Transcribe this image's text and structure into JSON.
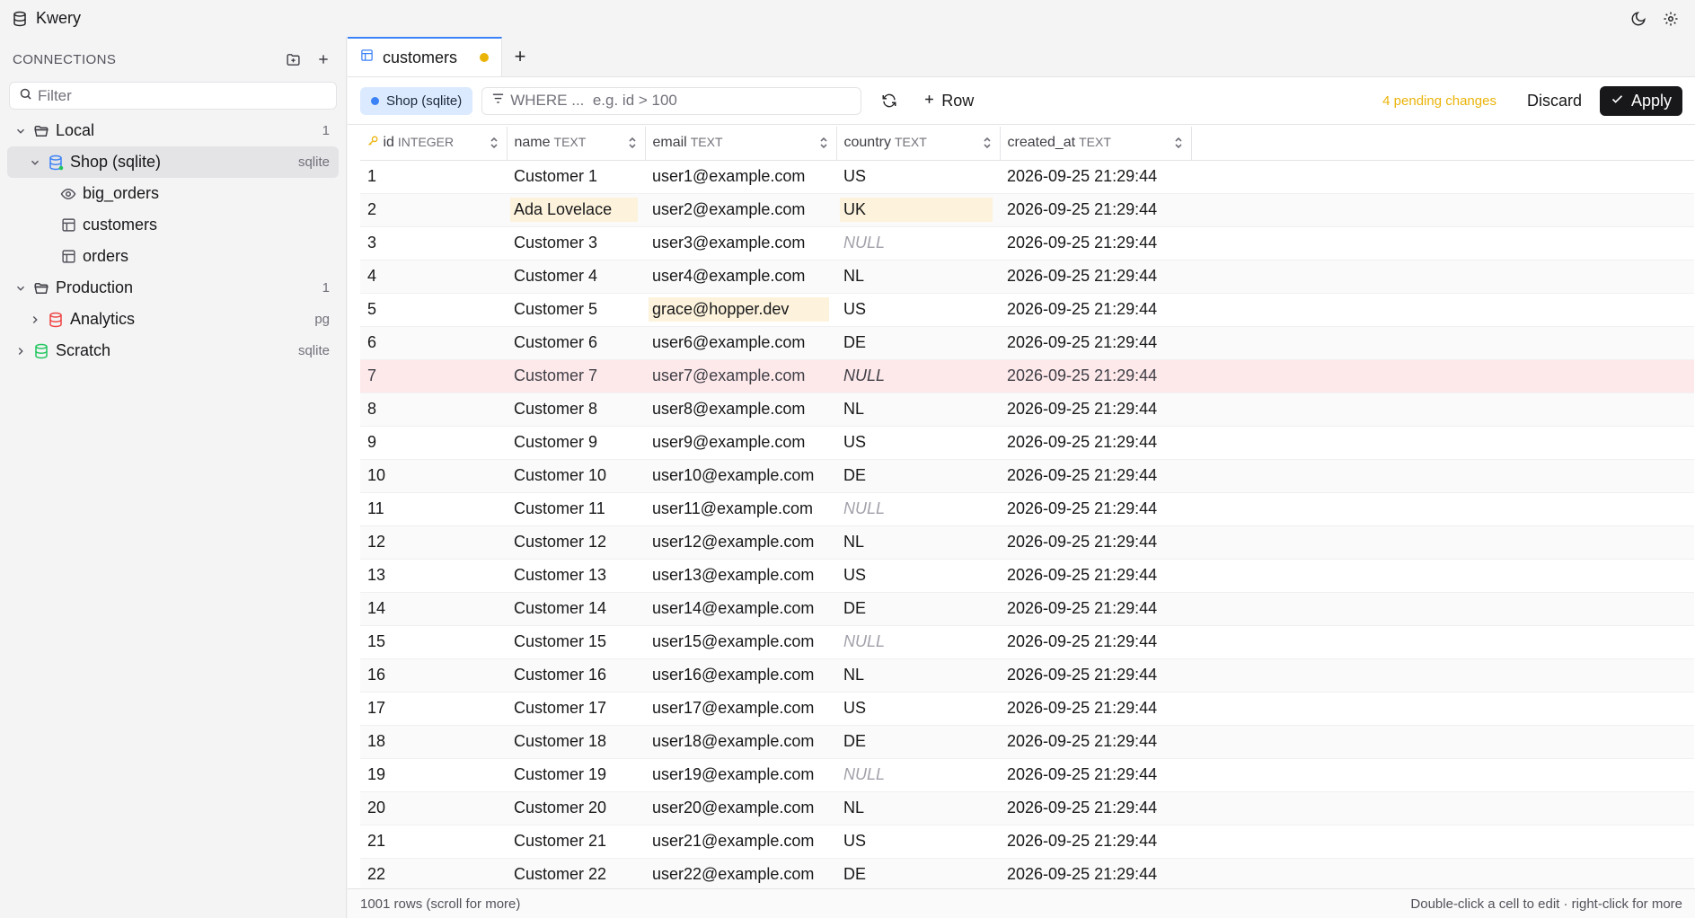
{
  "app": {
    "title": "Kwery"
  },
  "sidebar": {
    "header": "CONNECTIONS",
    "filter_placeholder": "Filter",
    "tree": [
      {
        "label": "Local",
        "meta": "1"
      },
      {
        "label": "Shop (sqlite)",
        "meta": "sqlite"
      },
      {
        "label": "big_orders"
      },
      {
        "label": "customers"
      },
      {
        "label": "orders"
      },
      {
        "label": "Production",
        "meta": "1"
      },
      {
        "label": "Analytics",
        "meta": "pg"
      },
      {
        "label": "Scratch",
        "meta": "sqlite"
      }
    ]
  },
  "tabs": [
    {
      "label": "customers",
      "dirty": true
    }
  ],
  "tab_add": "+",
  "toolbar": {
    "connection": "Shop (sqlite)",
    "where_placeholder": "WHERE ...  e.g. id > 100",
    "add_row": "Row",
    "pending": "4 pending changes",
    "discard": "Discard",
    "apply": "Apply"
  },
  "table": {
    "columns": [
      {
        "name": "id",
        "type": "INTEGER"
      },
      {
        "name": "name",
        "type": "TEXT"
      },
      {
        "name": "email",
        "type": "TEXT"
      },
      {
        "name": "country",
        "type": "TEXT"
      },
      {
        "name": "created_at",
        "type": "TEXT"
      }
    ],
    "rows": [
      [
        "1",
        "Customer 1",
        "user1@example.com",
        "US",
        "2026-09-25 21:29:44"
      ],
      [
        "2",
        "Ada Lovelace",
        "user2@example.com",
        "UK",
        "2026-09-25 21:29:44"
      ],
      [
        "3",
        "Customer 3",
        "user3@example.com",
        "NULL",
        "2026-09-25 21:29:44"
      ],
      [
        "4",
        "Customer 4",
        "user4@example.com",
        "NL",
        "2026-09-25 21:29:44"
      ],
      [
        "5",
        "Customer 5",
        "grace@hopper.dev",
        "US",
        "2026-09-25 21:29:44"
      ],
      [
        "6",
        "Customer 6",
        "user6@example.com",
        "DE",
        "2026-09-25 21:29:44"
      ],
      [
        "7",
        "Customer 7",
        "user7@example.com",
        "NULL",
        "2026-09-25 21:29:44"
      ],
      [
        "8",
        "Customer 8",
        "user8@example.com",
        "NL",
        "2026-09-25 21:29:44"
      ],
      [
        "9",
        "Customer 9",
        "user9@example.com",
        "US",
        "2026-09-25 21:29:44"
      ],
      [
        "10",
        "Customer 10",
        "user10@example.com",
        "DE",
        "2026-09-25 21:29:44"
      ],
      [
        "11",
        "Customer 11",
        "user11@example.com",
        "NULL",
        "2026-09-25 21:29:44"
      ],
      [
        "12",
        "Customer 12",
        "user12@example.com",
        "NL",
        "2026-09-25 21:29:44"
      ],
      [
        "13",
        "Customer 13",
        "user13@example.com",
        "US",
        "2026-09-25 21:29:44"
      ],
      [
        "14",
        "Customer 14",
        "user14@example.com",
        "DE",
        "2026-09-25 21:29:44"
      ],
      [
        "15",
        "Customer 15",
        "user15@example.com",
        "NULL",
        "2026-09-25 21:29:44"
      ],
      [
        "16",
        "Customer 16",
        "user16@example.com",
        "NL",
        "2026-09-25 21:29:44"
      ],
      [
        "17",
        "Customer 17",
        "user17@example.com",
        "US",
        "2026-09-25 21:29:44"
      ],
      [
        "18",
        "Customer 18",
        "user18@example.com",
        "DE",
        "2026-09-25 21:29:44"
      ],
      [
        "19",
        "Customer 19",
        "user19@example.com",
        "NULL",
        "2026-09-25 21:29:44"
      ],
      [
        "20",
        "Customer 20",
        "user20@example.com",
        "NL",
        "2026-09-25 21:29:44"
      ],
      [
        "21",
        "Customer 21",
        "user21@example.com",
        "US",
        "2026-09-25 21:29:44"
      ],
      [
        "22",
        "Customer 22",
        "user22@example.com",
        "DE",
        "2026-09-25 21:29:44"
      ]
    ],
    "edited_cells": [
      [
        1,
        1
      ],
      [
        1,
        3
      ],
      [
        4,
        2
      ]
    ],
    "deleted_rows": [
      6
    ]
  },
  "status": {
    "rows": "1001 rows (scroll for more)",
    "hint": "Double-click a cell to edit · right-click for more"
  },
  "colors": {
    "accent": "#3b82f6",
    "pending": "#eab308",
    "edited": "#fdf3dc",
    "deleted": "#fde8ea"
  }
}
